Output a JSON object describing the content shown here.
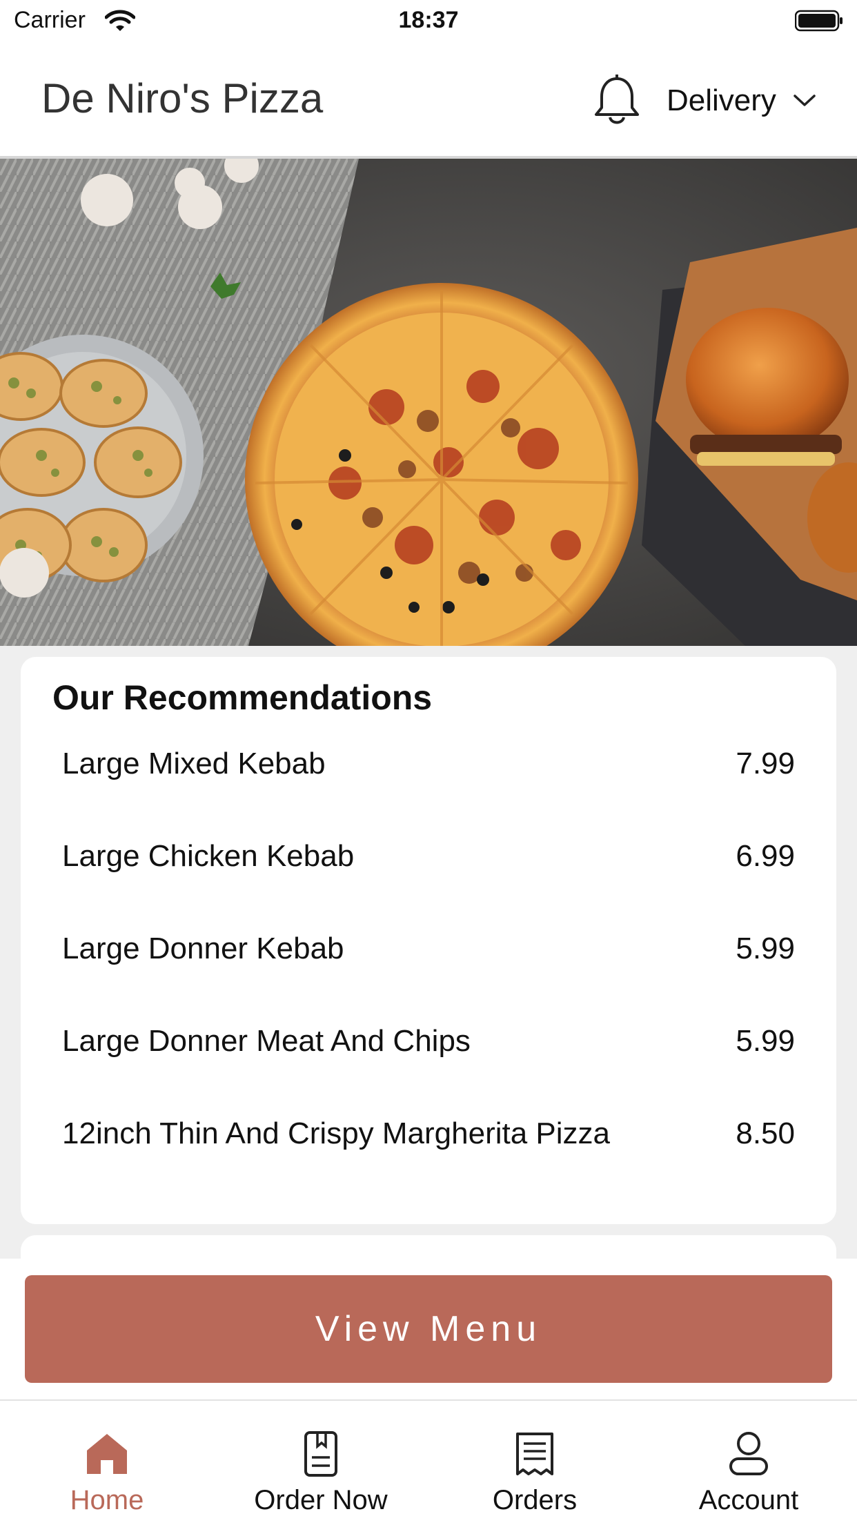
{
  "status_bar": {
    "carrier": "Carrier",
    "time": "18:37"
  },
  "header": {
    "title": "De Niro's Pizza",
    "notification_icon": "bell-icon",
    "delivery_mode": "Delivery",
    "dropdown_icon": "chevron-down-icon"
  },
  "hero": {
    "image": "food-banner-image"
  },
  "recommendations": {
    "title": "Our Recommendations",
    "items": [
      {
        "name": "Large Mixed Kebab",
        "price": "7.99"
      },
      {
        "name": "Large Chicken Kebab",
        "price": "6.99"
      },
      {
        "name": "Large Donner Kebab",
        "price": "5.99"
      },
      {
        "name": "Large Donner Meat And Chips",
        "price": "5.99"
      },
      {
        "name": "12inch Thin And Crispy Margherita Pizza",
        "price": "8.50"
      }
    ]
  },
  "view_menu_label": "View Menu",
  "tabs": [
    {
      "label": "Home",
      "icon": "home-icon",
      "active": true
    },
    {
      "label": "Order Now",
      "icon": "menu-book-icon",
      "active": false
    },
    {
      "label": "Orders",
      "icon": "receipt-icon",
      "active": false
    },
    {
      "label": "Account",
      "icon": "person-icon",
      "active": false
    }
  ],
  "colors": {
    "accent": "#b96959",
    "active_tab": "#b96959"
  }
}
